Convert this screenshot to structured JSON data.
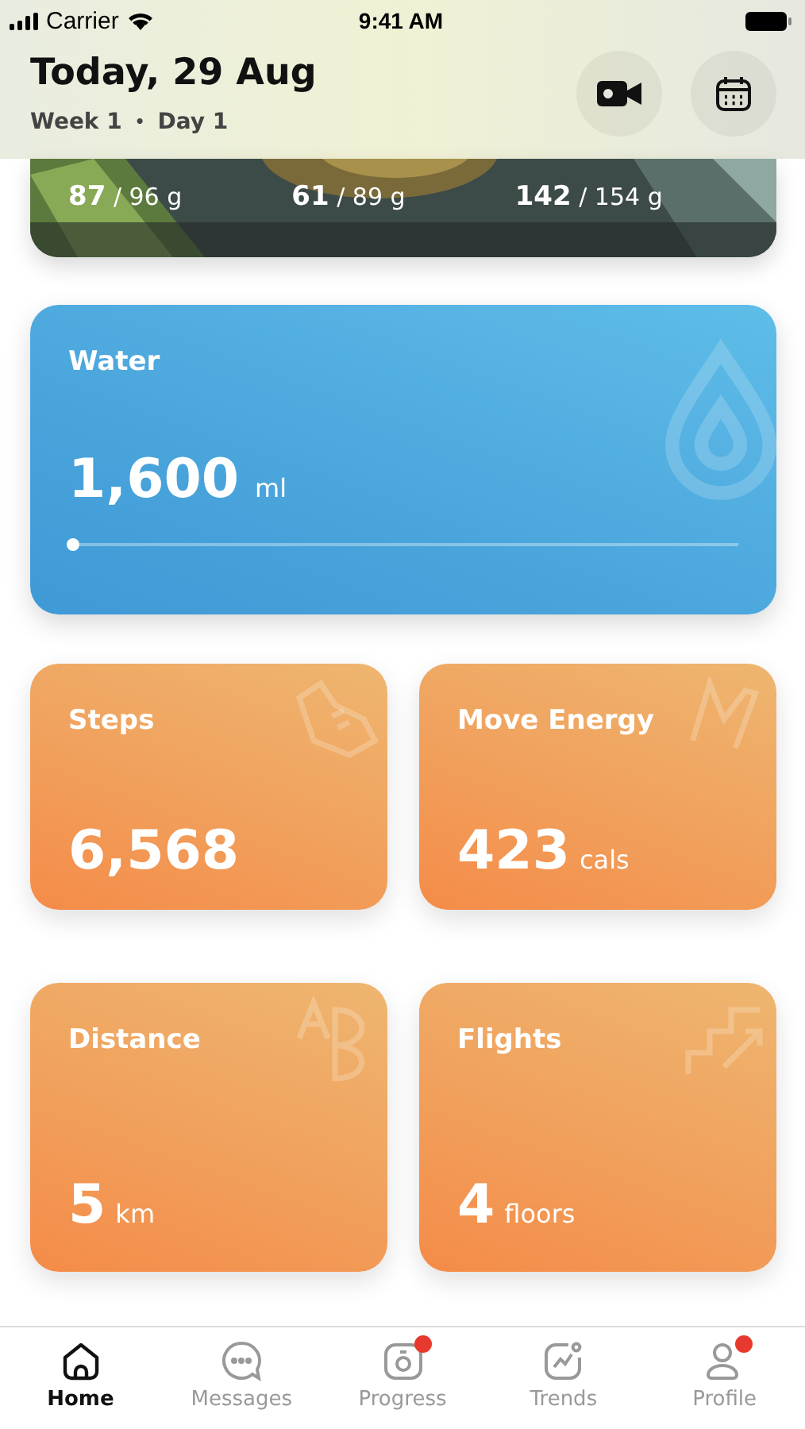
{
  "status_bar": {
    "carrier": "Carrier",
    "time": "9:41 AM"
  },
  "header": {
    "title": "Today, 29 Aug",
    "week": "Week 1",
    "separator": "•",
    "day": "Day 1"
  },
  "macros": {
    "kind": "picture",
    "items": [
      {
        "value": "87",
        "target": "/ 96 g"
      },
      {
        "value": "61",
        "target": "/ 89 g"
      },
      {
        "value": "142",
        "target": "/ 154 g"
      }
    ]
  },
  "water": {
    "label": "Water",
    "value": "1,600",
    "unit": "ml",
    "level": 0.0
  },
  "tiles": [
    {
      "kind": "steps",
      "label": "Steps",
      "value": "6,568"
    },
    {
      "kind": "energy",
      "label": "Move Energy",
      "value": "423",
      "unit": "cals"
    },
    {
      "kind": "distance",
      "label": "Distance",
      "value": "5",
      "unit": "km"
    },
    {
      "kind": "flights",
      "label": "Flights",
      "value": "4",
      "unit": "floors"
    }
  ],
  "tab_bar": [
    {
      "kind": "home",
      "label": "Home",
      "selected": true,
      "badge": false
    },
    {
      "kind": "messages",
      "label": "Messages",
      "selected": false,
      "badge": false
    },
    {
      "kind": "progress",
      "label": "Progress",
      "selected": false,
      "badge": true
    },
    {
      "kind": "trends",
      "label": "Trends",
      "selected": false,
      "badge": false
    },
    {
      "kind": "profile",
      "label": "Profile",
      "selected": false,
      "badge": true
    }
  ]
}
